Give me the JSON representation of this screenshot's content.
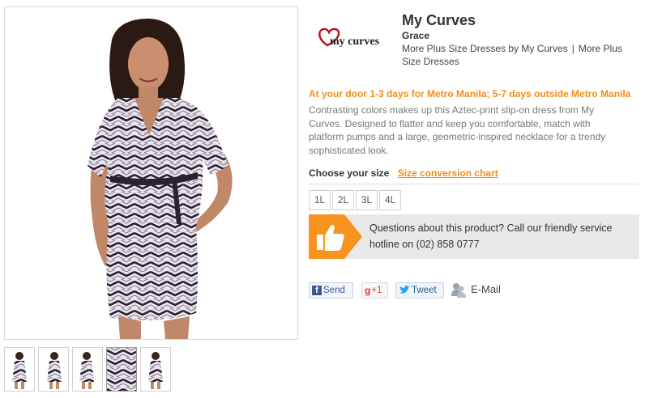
{
  "product": {
    "brand_logo_text": "my curves",
    "title": "My Curves",
    "subtitle": "Grace",
    "more_link_1": "More Plus Size Dresses by My Curves",
    "separator": "|",
    "more_link_2": "More Plus Size Dresses",
    "delivery": "At your door 1-3 days for Metro Manila; 5-7 days outside Metro Manila",
    "description": "Contrasting colors makes up this Aztec-print slip-on dress from My Curves. Designed to flatter and keep you comfortable, match with platform pumps and a large, geometric-inspired necklace for a trendy sophisticated look."
  },
  "sizes": {
    "label": "Choose your size",
    "chart_link": "Size conversion chart",
    "options": [
      "1L",
      "2L",
      "3L",
      "4L"
    ]
  },
  "service": {
    "text": "Questions about this product? Call our friendly service hotline on (02) 858 0777",
    "icon": "thumbs-up-icon"
  },
  "share": {
    "facebook_label": "Send",
    "gplus_label": "+1",
    "twitter_label": "Tweet",
    "email_label": "E-Mail"
  },
  "gallery": {
    "thumbnail_count": 5,
    "active_index": 3
  },
  "colors": {
    "accent": "#f08c1c",
    "service_tab": "#f7931e",
    "dress_dark": "#2a2233",
    "dress_light": "#e8e2ec"
  }
}
